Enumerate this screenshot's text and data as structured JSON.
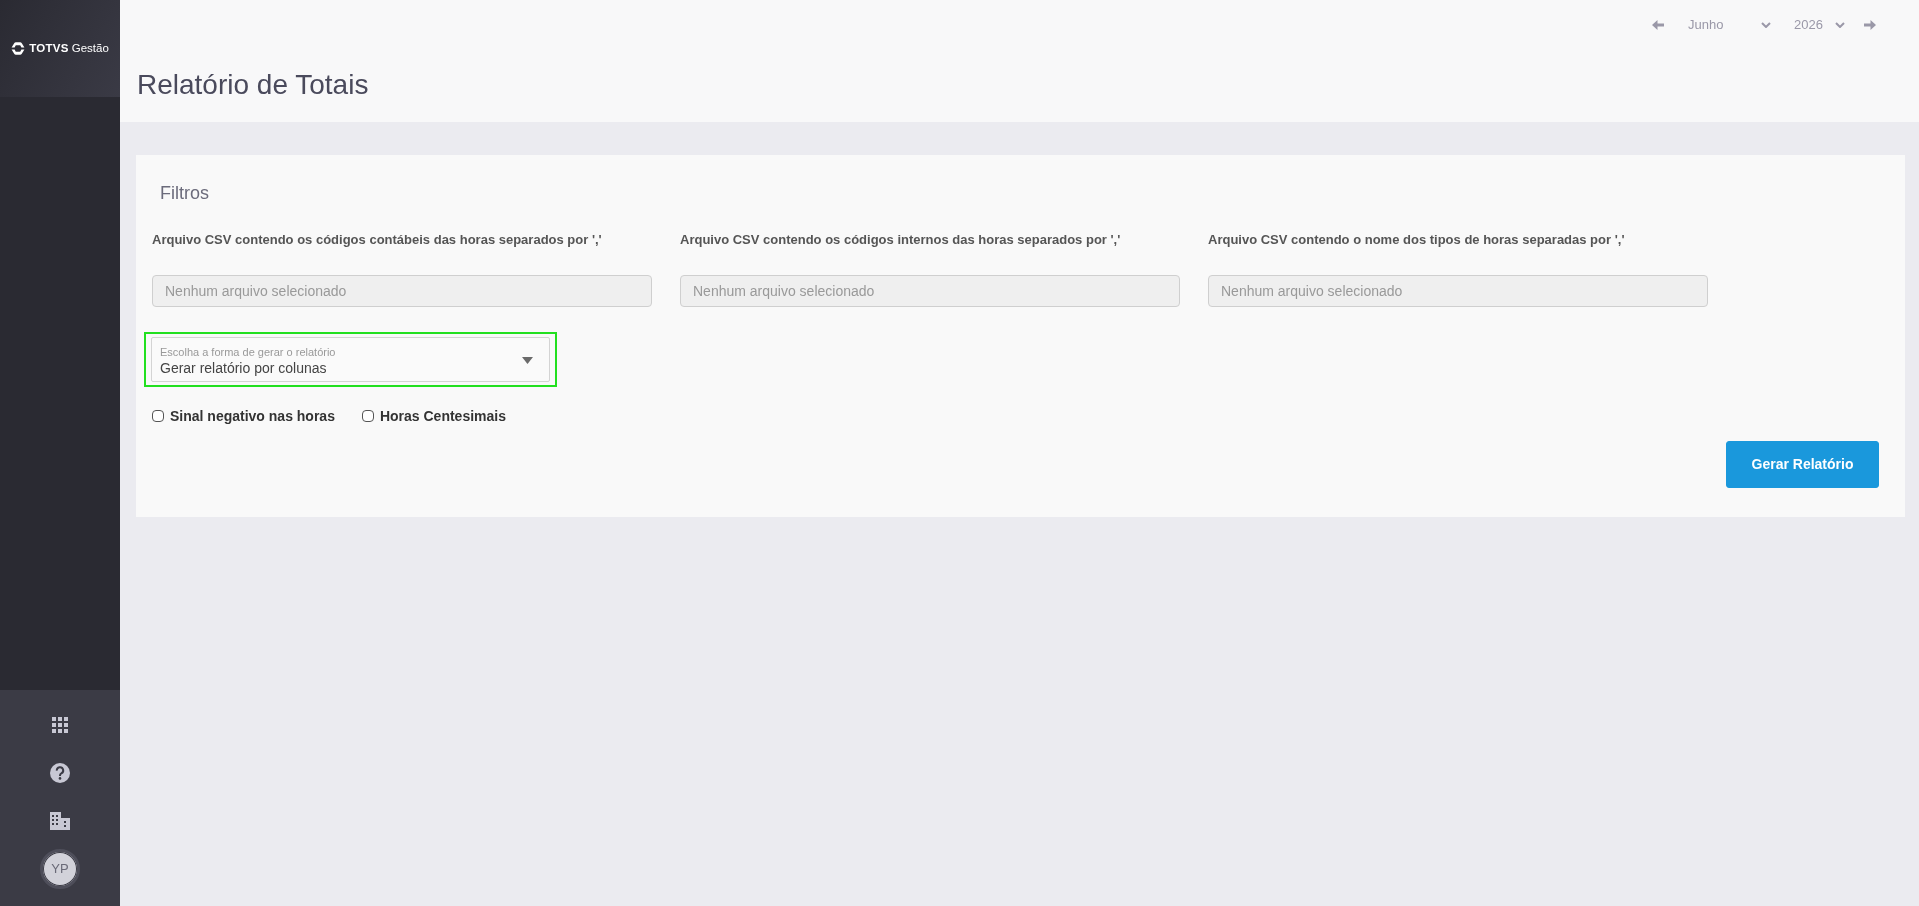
{
  "sidebar": {
    "logo": {
      "brand": "TOTVS",
      "product": "Gestão"
    },
    "avatar": {
      "initials": "YP"
    }
  },
  "period": {
    "month": "Junho",
    "year": "2026"
  },
  "page": {
    "title": "Relatório de Totais"
  },
  "filters": {
    "title": "Filtros",
    "file_fields": [
      {
        "label": "Arquivo CSV contendo os códigos contábeis das horas separados por ','",
        "placeholder": "Nenhum arquivo selecionado"
      },
      {
        "label": "Arquivo CSV contendo os códigos internos das horas separados por ','",
        "placeholder": "Nenhum arquivo selecionado"
      },
      {
        "label": "Arquivo CSV contendo o nome dos tipos de horas separadas por ','",
        "placeholder": "Nenhum arquivo selecionado"
      }
    ],
    "report_mode": {
      "label": "Escolha a forma de gerar o relatório",
      "value": "Gerar relatório por colunas",
      "focused": true
    },
    "checkboxes": [
      {
        "label": "Sinal negativo nas horas",
        "checked": false
      },
      {
        "label": "Horas Centesimais",
        "checked": false
      }
    ],
    "submit": "Gerar Relatório"
  }
}
